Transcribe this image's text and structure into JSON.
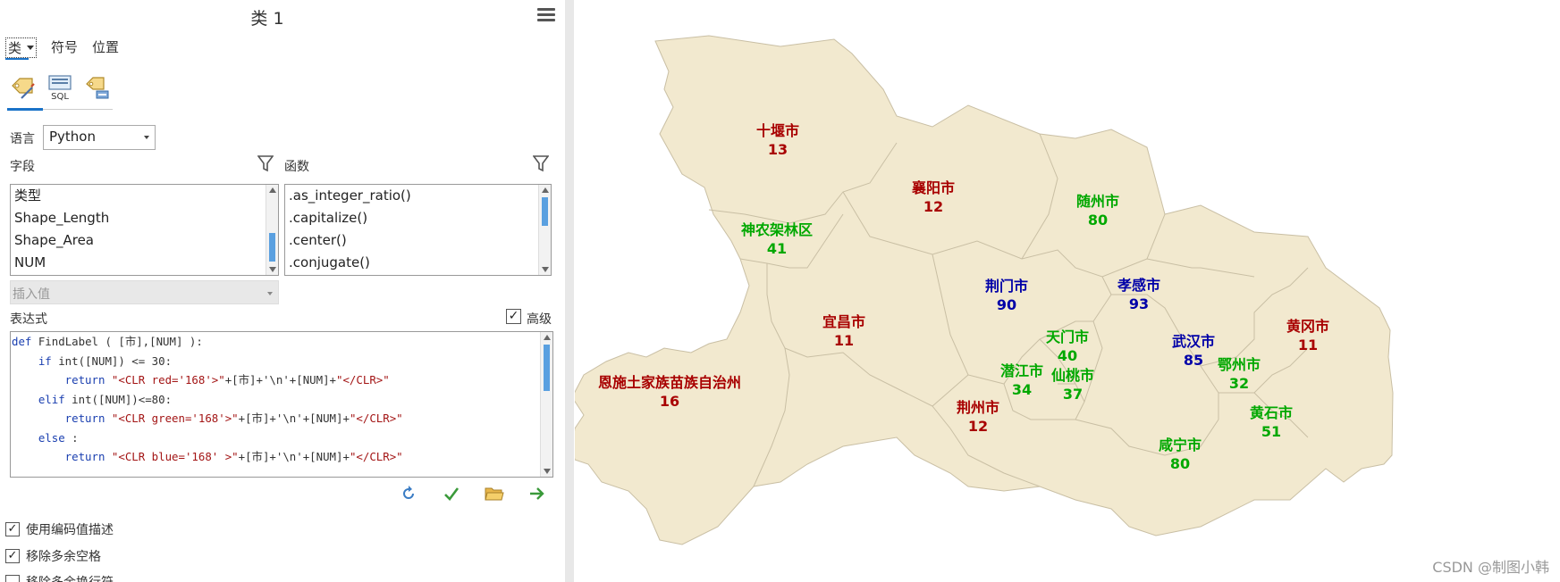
{
  "pane": {
    "title": "类 1",
    "tabs": {
      "class": "类",
      "symbol": "符号",
      "position": "位置"
    },
    "language_label": "语言",
    "language_value": "Python",
    "fields_label": "字段",
    "functions_label": "函数",
    "fields": [
      "类型",
      "Shape_Length",
      "Shape_Area",
      "NUM"
    ],
    "functions": [
      ".as_integer_ratio()",
      ".capitalize()",
      ".center()",
      ".conjugate()"
    ],
    "insert_value": "插入值",
    "expression_label": "表达式",
    "advanced_label": "高级",
    "code": {
      "l1_kw": "def",
      "l1": " FindLabel ( [市],[NUM] ):",
      "l2_kw": "    if",
      "l2": " int([NUM]) <= 30:",
      "l3_kw": "        return",
      "l3_str": " \"<CLR red='168'>\"",
      "l3": "+[市]+'\\n'+[NUM]+",
      "l3_end": "\"</CLR>\"",
      "l4_kw": "    elif",
      "l4": " int([NUM])<=80:",
      "l5_kw": "        return",
      "l5_str": " \"<CLR green='168'>\"",
      "l5": "+[市]+'\\n'+[NUM]+",
      "l5_end": "\"</CLR>\"",
      "l6_kw": "    else",
      "l6": " :",
      "l7_kw": "        return",
      "l7_str": " \"<CLR blue='168' >\"",
      "l7": "+[市]+'\\n'+[NUM]+",
      "l7_end": "\"</CLR>\""
    },
    "checkboxes": [
      {
        "label": "使用编码值描述",
        "checked": "✓"
      },
      {
        "label": "移除多余空格",
        "checked": "✓"
      },
      {
        "label": "移除多余换行符",
        "checked": ""
      }
    ],
    "checked_mark": "✓"
  },
  "map": {
    "colors": {
      "fill": "#f2e9cf",
      "stroke": "#c9bfa4",
      "red": "#a80000",
      "green": "#00a800",
      "blue": "#0000a8"
    },
    "labels": [
      {
        "name": "十堰市",
        "num": "13",
        "color": "red"
      },
      {
        "name": "襄阳市",
        "num": "12",
        "color": "red"
      },
      {
        "name": "随州市",
        "num": "80",
        "color": "green"
      },
      {
        "name": "神农架林区",
        "num": "41",
        "color": "green"
      },
      {
        "name": "荆门市",
        "num": "90",
        "color": "blue"
      },
      {
        "name": "孝感市",
        "num": "93",
        "color": "blue"
      },
      {
        "name": "宜昌市",
        "num": "11",
        "color": "red"
      },
      {
        "name": "黄冈市",
        "num": "11",
        "color": "red"
      },
      {
        "name": "天门市",
        "num": "40",
        "color": "green"
      },
      {
        "name": "武汉市",
        "num": "85",
        "color": "blue"
      },
      {
        "name": "恩施土家族苗族自治州",
        "num": "16",
        "color": "red"
      },
      {
        "name": "潜江市",
        "num": "34",
        "color": "green"
      },
      {
        "name": "仙桃市",
        "num": "37",
        "color": "green"
      },
      {
        "name": "鄂州市",
        "num": "32",
        "color": "green"
      },
      {
        "name": "荆州市",
        "num": "12",
        "color": "red"
      },
      {
        "name": "黄石市",
        "num": "51",
        "color": "green"
      },
      {
        "name": "咸宁市",
        "num": "80",
        "color": "green"
      }
    ],
    "watermark": "CSDN @制图小韩"
  }
}
